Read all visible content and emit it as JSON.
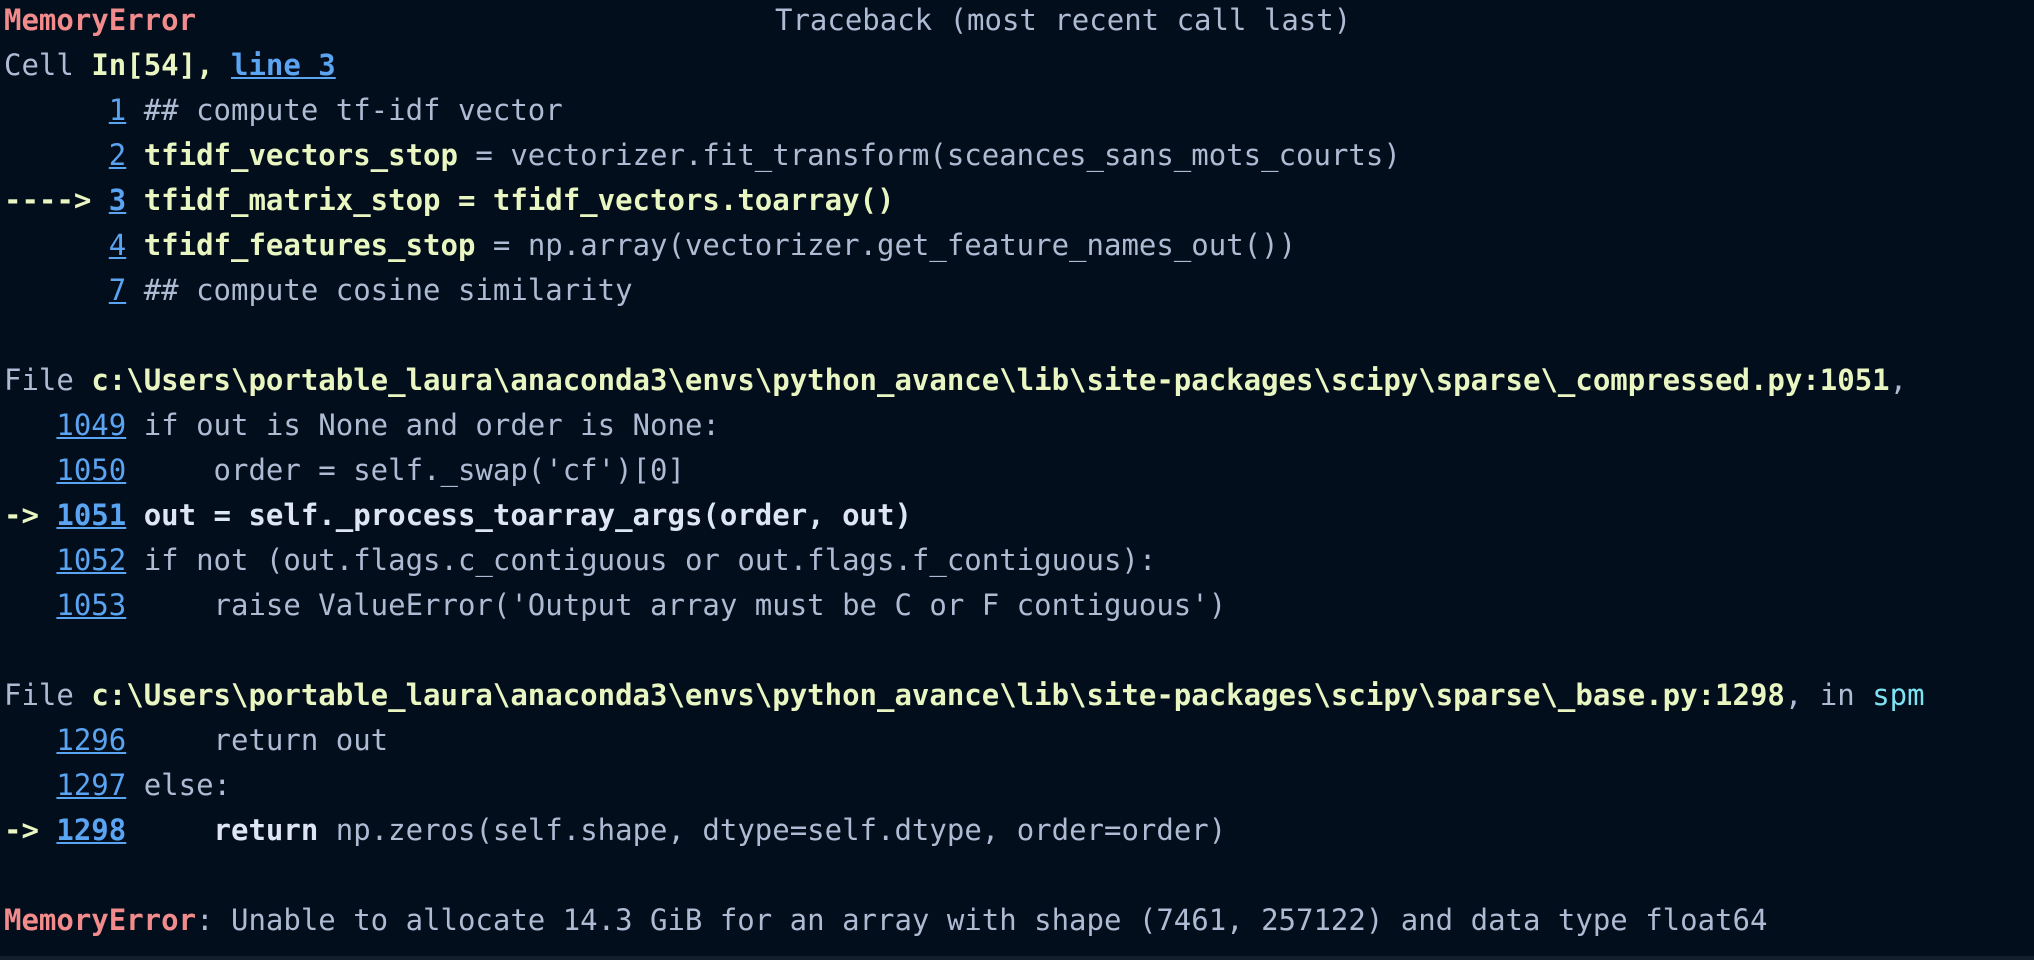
{
  "traceback": {
    "error_name": "MemoryError",
    "header_title": "Traceback (most recent call last)",
    "cell_prefix": "Cell ",
    "cell_in": "In[54], ",
    "cell_line_link": "line 3",
    "frame1": {
      "lines": [
        {
          "prefix": "      ",
          "num": "1",
          "code": " ## compute tf-idf vector"
        },
        {
          "prefix": "      ",
          "num": "2",
          "code_bold": " tfidf_vectors_stop",
          "code": " = vectorizer.fit_transform(sceances_sans_mots_courts)"
        },
        {
          "prefix": "----> ",
          "num": "3",
          "code_bold": " tfidf_matrix_stop = tfidf_vectors.toarray()"
        },
        {
          "prefix": "      ",
          "num": "4",
          "code_bold": " tfidf_features_stop",
          "code": " = np.array(vectorizer.get_feature_names_out())"
        },
        {
          "prefix": "      ",
          "num": "7",
          "code": " ## compute cosine similarity"
        }
      ]
    },
    "file_label": "File ",
    "frame2": {
      "path": "c:\\Users\\portable_laura\\anaconda3\\envs\\python_avance\\lib\\site-packages\\scipy\\sparse\\_compressed.py:1051",
      "suffix": ",",
      "lines": [
        {
          "prefix": "   ",
          "num": "1049",
          "code": " if out is None and order is None:"
        },
        {
          "prefix": "   ",
          "num": "1050",
          "code": "     order = self._swap('cf')[0]"
        },
        {
          "prefix": "-> ",
          "num": "1051",
          "code_bold": " out = self._process_toarray_args(order, out)"
        },
        {
          "prefix": "   ",
          "num": "1052",
          "code": " if not (out.flags.c_contiguous or out.flags.f_contiguous):"
        },
        {
          "prefix": "   ",
          "num": "1053",
          "code": "     raise ValueError('Output array must be C or F contiguous')"
        }
      ]
    },
    "frame3": {
      "path": "c:\\Users\\portable_laura\\anaconda3\\envs\\python_avance\\lib\\site-packages\\scipy\\sparse\\_base.py:1298",
      "in_word": ", in ",
      "func": "spm",
      "lines": [
        {
          "prefix": "   ",
          "num": "1296",
          "code": "     return out"
        },
        {
          "prefix": "   ",
          "num": "1297",
          "code": " else:"
        },
        {
          "prefix": "-> ",
          "num": "1298",
          "indent": "     ",
          "kw": "return",
          "code": " np.zeros(self.shape, dtype=self.dtype, order=order)"
        }
      ]
    },
    "final_message": ": Unable to allocate 14.3 GiB for an array with shape (7461, 257122) and data type float64"
  }
}
